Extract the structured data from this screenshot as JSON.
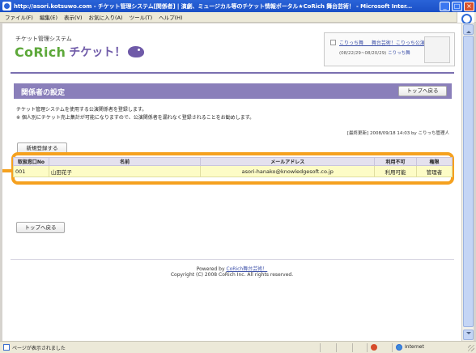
{
  "window": {
    "title": "http://asori.kotsuwo.com - チケット管理システム[関係者] | 演劇、ミュージカル等のチケット情報ポータル★CoRich 舞台芸術！ - Microsoft Inter...",
    "minimize": "_",
    "maximize": "□",
    "close": "×"
  },
  "menu": [
    "ファイル(F)",
    "編集(E)",
    "表示(V)",
    "お気に入り(A)",
    "ツール(T)",
    "ヘルプ(H)"
  ],
  "header": {
    "system_name": "チケット管理システム",
    "logo_text": "CoRich",
    "logo_text2": "チケット！",
    "login_link": "こりっち舞 　 舞台芸術！こりっち公演",
    "login_sub": "(08/22/29~08/20/29)",
    "login_sub_link": "こりっち舞"
  },
  "section": {
    "title": "関係者の設定",
    "back_button": "トップへ戻る"
  },
  "description": {
    "line1": "チケット管理システムを使用する公演関係者を登録します。",
    "line2": "※ 個人別にチケット売上集計が可能になりますので、公演関係者を漏れなく登録されることをお勧めします。"
  },
  "updated": "[最終更新] 2008/09/18 14:03 by こりっち管理人",
  "new_button": "新規登録する",
  "table": {
    "headers": [
      "取扱窓口No",
      "名前",
      "メールアドレス",
      "利用不可",
      "権限"
    ],
    "rows": [
      [
        "001",
        "山田花子",
        "asori-hanako@knowledgesoft.co.jp",
        "利用可能",
        "管理者"
      ]
    ]
  },
  "bottom_back_button": "トップへ戻る",
  "footer": {
    "powered_by": "Powered by",
    "powered_link": "CoRich舞台芸術！",
    "copyright": "Copyright (C) 2008 CoRich Inc. All rights reserved."
  },
  "statusbar": {
    "status": "ページが表示されました",
    "zone": "Internet"
  },
  "colors": {
    "accent": "#8a7fba",
    "highlight": "#f5a11f",
    "row": "#fdfcc6",
    "logo_green": "#5da83a"
  }
}
